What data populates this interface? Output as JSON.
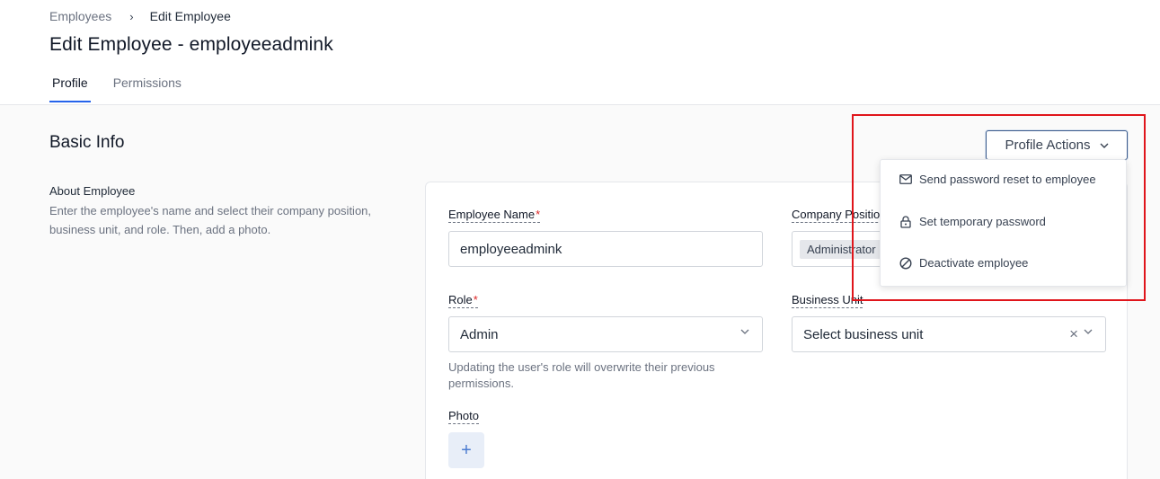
{
  "breadcrumb": {
    "parent": "Employees",
    "separator": "›",
    "current": "Edit Employee"
  },
  "page": {
    "title": "Edit Employee - employeeadmink"
  },
  "tabs": [
    {
      "label": "Profile",
      "active": true
    },
    {
      "label": "Permissions",
      "active": false
    }
  ],
  "section": {
    "title": "Basic Info"
  },
  "profile_actions": {
    "label": "Profile Actions",
    "menu": [
      {
        "label": "Send password reset to employee",
        "icon": "envelope-icon"
      },
      {
        "label": "Set temporary password",
        "icon": "lock-icon"
      },
      {
        "label": "Deactivate employee",
        "icon": "block-icon"
      }
    ]
  },
  "about": {
    "title": "About Employee",
    "description": "Enter the employee's name and select their company position, business unit, and role. Then, add a photo."
  },
  "form": {
    "employee_name": {
      "label": "Employee Name",
      "required_mark": "*",
      "value": "employeeadmink"
    },
    "company_position": {
      "label": "Company Position",
      "chip": "Administrator"
    },
    "role": {
      "label": "Role",
      "required_mark": "*",
      "value": "Admin",
      "help": "Updating the user's role will overwrite their previous permissions."
    },
    "business_unit": {
      "label": "Business Unit",
      "placeholder": "Select business unit",
      "clear": "×"
    },
    "photo": {
      "label": "Photo",
      "add": "+"
    }
  },
  "colors": {
    "accent": "#2563eb",
    "highlight": "#e0151b",
    "required": "#dc2626"
  }
}
